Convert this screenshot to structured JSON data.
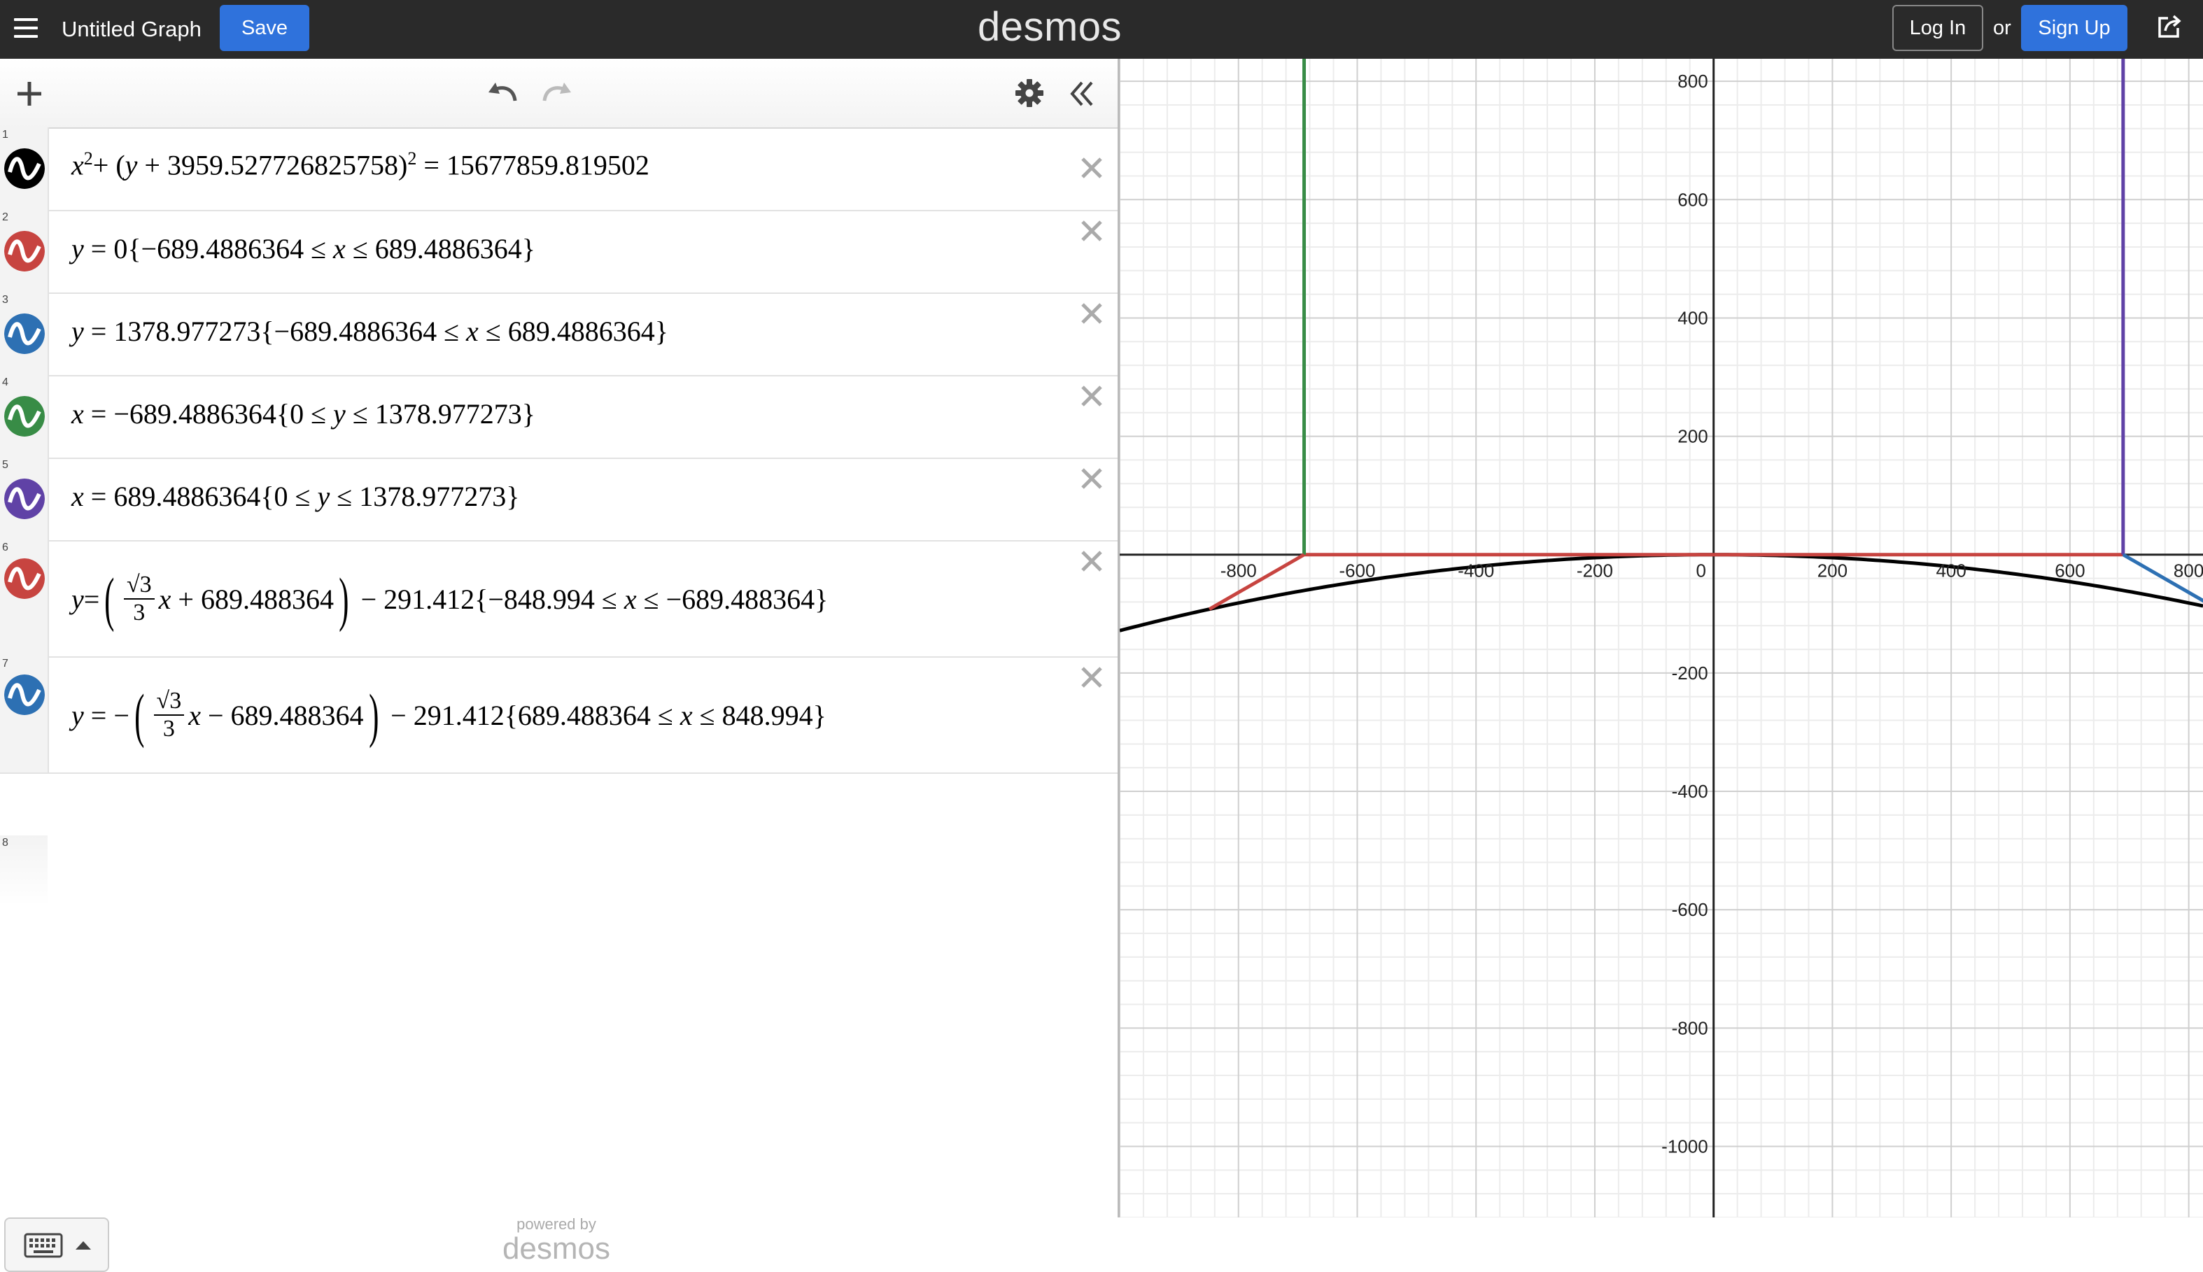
{
  "header": {
    "title": "Untitled Graph",
    "save_label": "Save",
    "logo": "desmos",
    "login_label": "Log In",
    "or_text": "or",
    "signup_label": "Sign Up"
  },
  "expressions": [
    {
      "num": "1",
      "color": "#000000",
      "parts": [
        "x",
        "2",
        "+ (",
        "y",
        " + 3959.527726825758)",
        "2",
        " = 15677859.819502"
      ]
    },
    {
      "num": "2",
      "color": "#c74440",
      "parts": [
        "y",
        " = 0{−689.4886364 ≤ ",
        "x",
        " ≤ 689.4886364}"
      ]
    },
    {
      "num": "3",
      "color": "#2d70b3",
      "parts": [
        "y",
        " = 1378.977273{−689.4886364 ≤ ",
        "x",
        " ≤ 689.4886364}"
      ]
    },
    {
      "num": "4",
      "color": "#388c46",
      "parts": [
        "x",
        " = −689.4886364{0 ≤ ",
        "y",
        " ≤ 1378.977273}"
      ]
    },
    {
      "num": "5",
      "color": "#6042a6",
      "parts": [
        "x",
        " = 689.4886364{0 ≤ ",
        "y",
        " ≤ 1378.977273}"
      ]
    },
    {
      "num": "6",
      "color": "#c74440",
      "parts": [
        "y",
        " = ",
        "√3",
        "3",
        "x",
        " + 689.488364",
        " − 291.412{−848.994 ≤ ",
        "x",
        " ≤ −689.488364}"
      ]
    },
    {
      "num": "7",
      "color": "#2d70b3",
      "parts": [
        "y",
        " = −",
        "√3",
        "3",
        "x",
        " − 689.488364",
        " − 291.412{689.488364 ≤ ",
        "x",
        " ≤ 848.994}"
      ]
    }
  ],
  "empty_row_num": "8",
  "footer": {
    "powered_by": "powered by",
    "brand": "desmos"
  },
  "graph": {
    "x_ticks": [
      "-800",
      "-600",
      "-400",
      "-200",
      "0",
      "200",
      "400",
      "600",
      "800"
    ],
    "y_ticks": [
      "800",
      "600",
      "400",
      "200",
      "-200",
      "-400",
      "-600",
      "-800",
      "-1000"
    ],
    "x_range": [
      -1000,
      824
    ],
    "y_range": [
      -1120,
      838
    ]
  }
}
